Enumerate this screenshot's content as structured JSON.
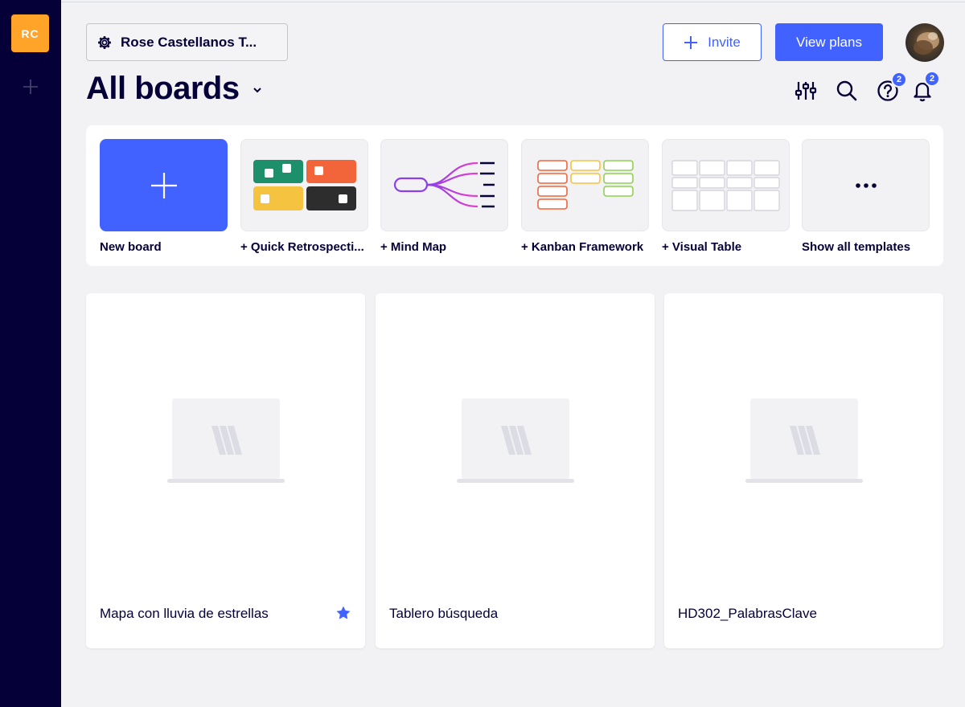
{
  "sidebar": {
    "workspace_initials": "RC",
    "add_icon": "plus-icon"
  },
  "header": {
    "team_name": "Rose Castellanos T...",
    "team_icon": "gear-icon",
    "invite_label": "Invite",
    "view_plans_label": "View plans",
    "page_title": "All boards",
    "help_badge": "2",
    "notifications_badge": "2"
  },
  "templates": [
    {
      "label": "New board",
      "icon": "plus-icon"
    },
    {
      "label": "+ Quick Retrospecti...",
      "icon": "retrospective-thumbnail"
    },
    {
      "label": "+ Mind Map",
      "icon": "mind-map-thumbnail"
    },
    {
      "label": "+ Kanban Framework",
      "icon": "kanban-thumbnail"
    },
    {
      "label": "+ Visual Table",
      "icon": "visual-table-thumbnail"
    },
    {
      "label": "Show all templates",
      "icon": "more-icon"
    }
  ],
  "boards": [
    {
      "name": "Mapa con lluvia de estrellas",
      "starred": true
    },
    {
      "name": "Tablero búsqueda",
      "starred": false
    },
    {
      "name": "HD302_PalabrasClave",
      "starred": false
    }
  ],
  "colors": {
    "accent": "#4262ff",
    "sidebar": "#050038",
    "workspace": "#ffa329"
  }
}
